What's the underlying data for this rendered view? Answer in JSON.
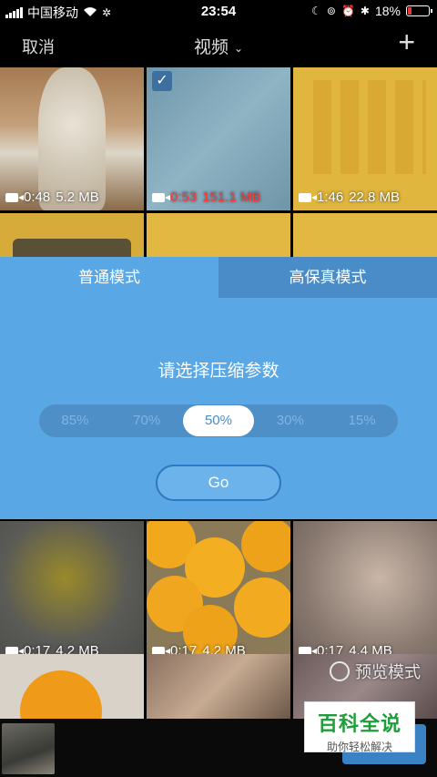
{
  "status_bar": {
    "carrier": "中国移动",
    "time": "23:54",
    "battery": "18%",
    "battery_level": 0.18
  },
  "nav": {
    "cancel": "取消",
    "title": "视频",
    "add": "+"
  },
  "tiles": [
    {
      "duration": "0:48",
      "size": "5.2 MB",
      "highlight": false
    },
    {
      "duration": "0:53",
      "size": "151.1 MB",
      "highlight": true,
      "checked": true
    },
    {
      "duration": "1:46",
      "size": "22.8 MB",
      "highlight": false
    },
    {
      "duration": "0:17",
      "size": "4.2 MB",
      "highlight": false
    },
    {
      "duration": "0:17",
      "size": "4.2 MB",
      "highlight": false
    },
    {
      "duration": "0:17",
      "size": "4.4 MB",
      "highlight": false
    }
  ],
  "modal": {
    "tabs": [
      "普通模式",
      "高保真模式"
    ],
    "active_tab": 0,
    "prompt": "请选择压缩参数",
    "options": [
      "85%",
      "70%",
      "50%",
      "30%",
      "15%"
    ],
    "selected_option": "50%",
    "go": "Go"
  },
  "preview_mode": "预览模式",
  "watermark": {
    "title": "百科全说",
    "subtitle": "助你轻松解决"
  }
}
